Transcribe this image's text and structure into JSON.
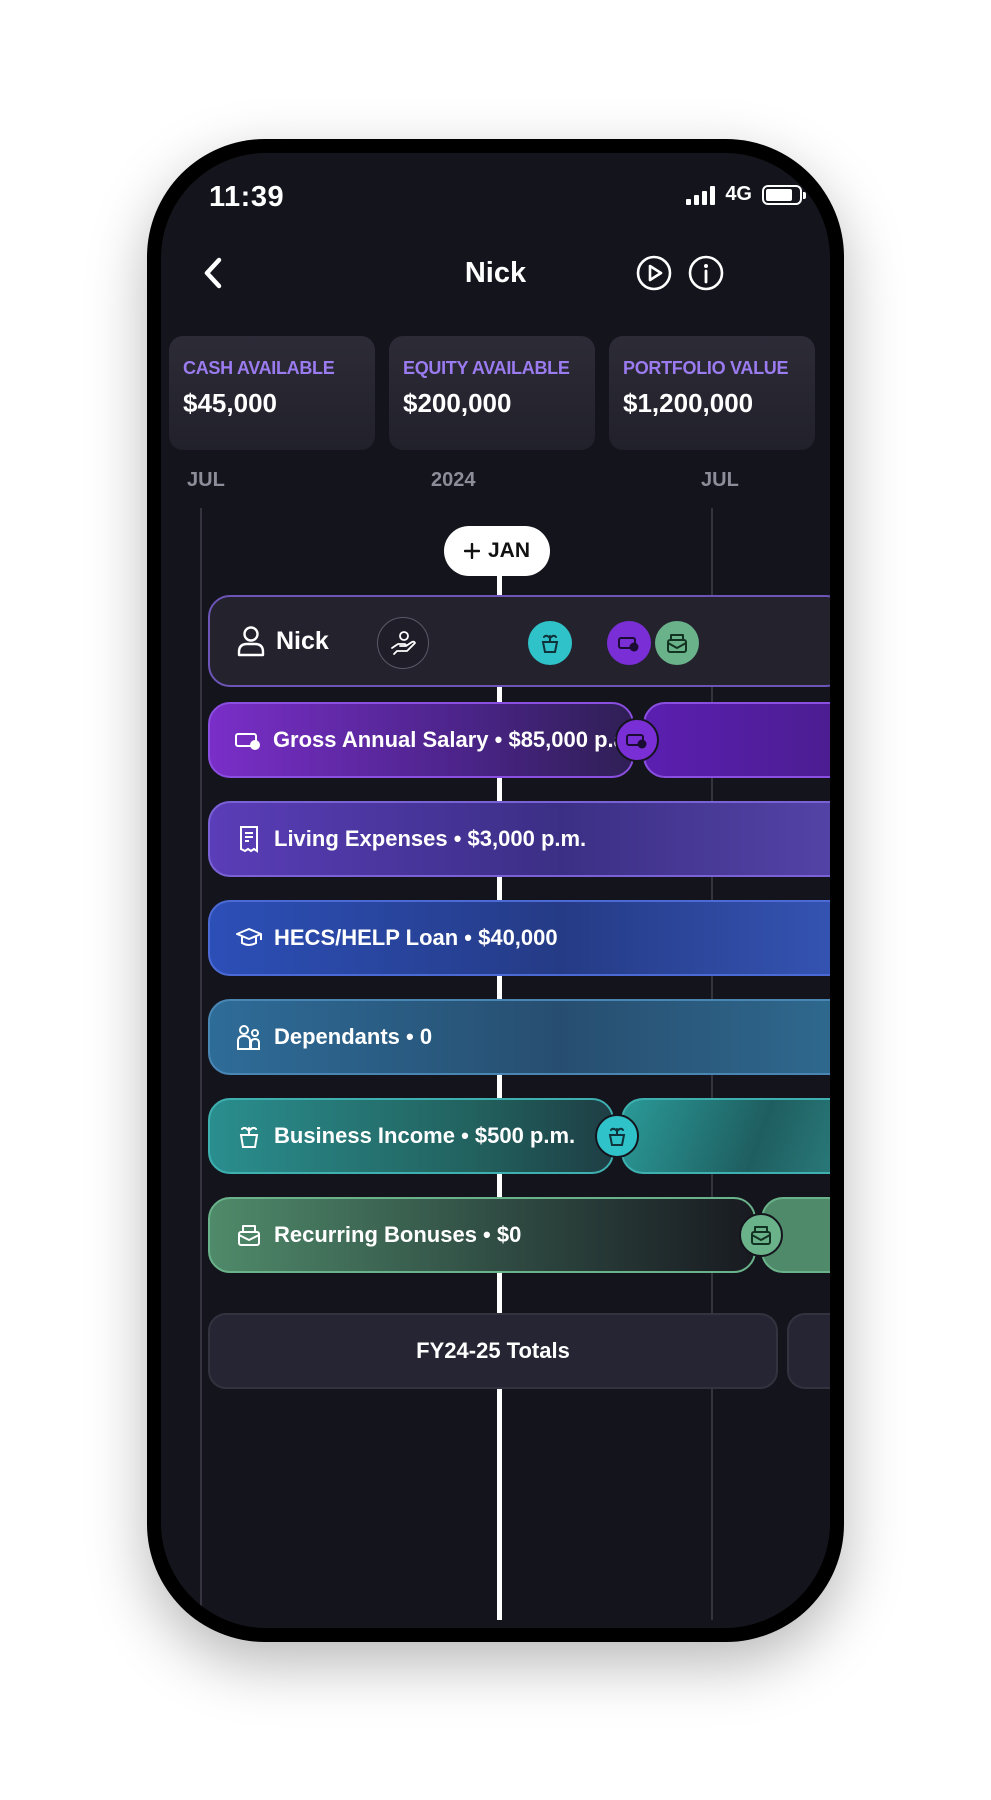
{
  "status_bar": {
    "time": "11:39",
    "network": "4G"
  },
  "header": {
    "title": "Nick"
  },
  "stats": [
    {
      "label": "CASH AVAILABLE",
      "value": "$45,000"
    },
    {
      "label": "EQUITY AVAILABLE",
      "value": "$200,000"
    },
    {
      "label": "PORTFOLIO VALUE",
      "value": "$1,200,000"
    }
  ],
  "timeline": {
    "left_label": "JUL",
    "year_label": "2024",
    "right_label": "JUL",
    "marker_label": "JAN"
  },
  "person": {
    "name": "Nick"
  },
  "rows": [
    {
      "text": "Gross Annual Salary • $85,000 p.a."
    },
    {
      "text": "Living Expenses • $3,000 p.m."
    },
    {
      "text": "HECS/HELP Loan • $40,000"
    },
    {
      "text": "Dependants • 0"
    },
    {
      "text": "Business Income • $500 p.m."
    },
    {
      "text": "Recurring Bonuses • $0"
    }
  ],
  "totals": {
    "label": "FY24-25 Totals"
  },
  "colors": {
    "accent_label": "#9b7bf0",
    "salary": "#7a35c9",
    "living": "#5b3fb8",
    "hecs": "#2e4fb0",
    "dependants": "#2f6a93",
    "business": "#2c8f8f",
    "bonuses": "#4f8a6a"
  }
}
